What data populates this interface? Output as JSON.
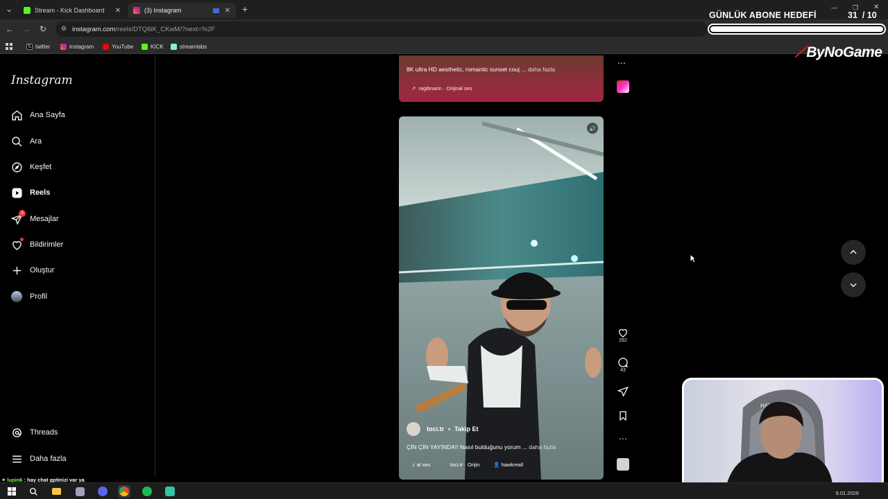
{
  "browser": {
    "tabs": [
      {
        "title": "Stream - Kick Dashboard",
        "favicon_color": "#53fc18"
      },
      {
        "title": "(3) Instagram",
        "favicon_color": "#e1306c"
      }
    ],
    "url_main": "instagram.com",
    "url_rest": "/reels/DTQ6iK_CKwM/?next=%2F",
    "bookmarks": [
      {
        "label": "twitter",
        "icon": "x-icon"
      },
      {
        "label": "instagram",
        "icon": "instagram-icon"
      },
      {
        "label": "YouTube",
        "icon": "youtube-icon"
      },
      {
        "label": "KICK",
        "icon": "kick-icon"
      },
      {
        "label": "streamlabs",
        "icon": "streamlabs-icon"
      }
    ]
  },
  "overlay": {
    "goal_title": "GÜNLÜK ABONE HEDEFİ",
    "goal_current": "31",
    "goal_total": "/ 10",
    "goal_progress": 1.0,
    "brand": "ByNoGame"
  },
  "instagram": {
    "logo": "Instagram",
    "nav": [
      {
        "label": "Ana Sayfa",
        "icon": "home-icon"
      },
      {
        "label": "Ara",
        "icon": "search-icon"
      },
      {
        "label": "Keşfet",
        "icon": "compass-icon"
      },
      {
        "label": "Reels",
        "icon": "reels-icon"
      },
      {
        "label": "Mesajlar",
        "icon": "messages-icon",
        "badge": "3"
      },
      {
        "label": "Bildirimler",
        "icon": "heart-icon"
      },
      {
        "label": "Oluştur",
        "icon": "plus-icon"
      },
      {
        "label": "Profil",
        "icon": "profile-avatar"
      }
    ],
    "nav_bottom": [
      {
        "label": "Threads",
        "icon": "threads-icon"
      },
      {
        "label": "Daha fazla",
        "icon": "menu-icon"
      }
    ],
    "prev_reel": {
      "caption": "8K ultra HD aesthetic, romantic sunset couj ...",
      "more": "daha fazla",
      "audio": "ragibnarin · Orijinal ses"
    },
    "reel": {
      "username": "toci.tr",
      "follow": "Takip Et",
      "caption": "ÇİN ÇİN YAYINDA!! Nasıl bulduğunu yorum ...",
      "more": "daha fazla",
      "audio_left": "al ses",
      "audio_mid": "toci.tr · Orijin",
      "tagged": "hawkreall",
      "likes": "292",
      "comments": "43"
    }
  },
  "taskbar": {
    "chat_user": "lupin6",
    "chat_message": " : hay chat gptinizi var ya",
    "date": "9.01.2026"
  }
}
